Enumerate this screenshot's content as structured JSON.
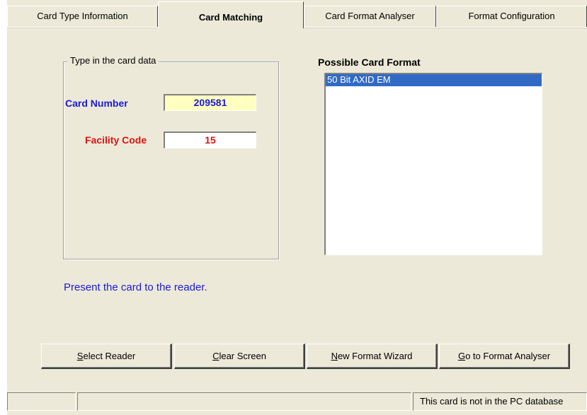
{
  "tabs": [
    {
      "label": "Card Type Information",
      "active": false
    },
    {
      "label": "Card Matching",
      "active": true
    },
    {
      "label": "Card Format Analyser",
      "active": false
    },
    {
      "label": "Format Configuration",
      "active": false
    }
  ],
  "card_data_group": {
    "title": "Type in the card data",
    "card_number_label": "Card Number",
    "card_number_value": "209581",
    "facility_code_label": "Facility Code",
    "facility_code_value": "15"
  },
  "possible_formats": {
    "title": "Possible Card Format",
    "items": [
      "50 Bit AXID EM"
    ]
  },
  "hint_text": "Present the card to the reader.",
  "buttons": {
    "select_reader": {
      "mnemonic": "S",
      "rest": "elect Reader"
    },
    "clear_screen": {
      "mnemonic": "C",
      "rest": "lear Screen"
    },
    "new_format_wizard": {
      "mnemonic": "N",
      "rest": "ew Format Wizard"
    },
    "go_to_format_analyser": {
      "mnemonic": "G",
      "rest": "o to Format Analyser"
    }
  },
  "status_bar": {
    "panel1": "",
    "panel2": "",
    "panel3": "This card is not in the PC database"
  },
  "colors": {
    "card_number_label": "#1a1adc",
    "facility_code_label": "#e01010",
    "card_number_bg": "#ffffc0",
    "selection": "#316ac5"
  }
}
